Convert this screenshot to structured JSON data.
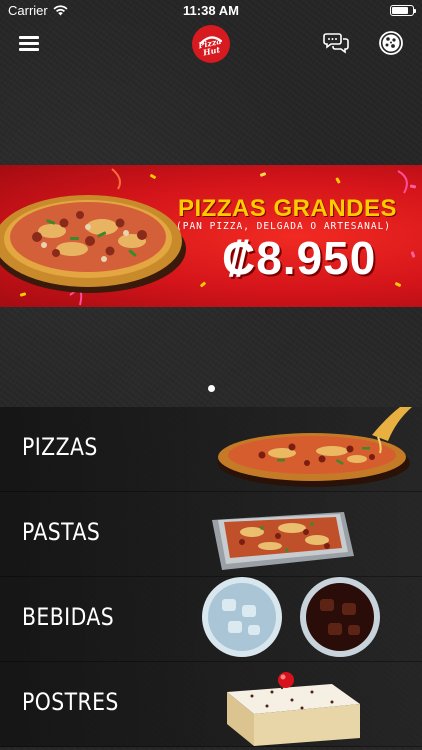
{
  "status_bar": {
    "carrier": "Carrier",
    "time": "11:38 AM"
  },
  "nav": {
    "logo_text_line1": "Pizza",
    "logo_text_line2": "Hut",
    "menu_icon": "hamburger-menu-icon",
    "chat_icon": "chat-bubbles-icon",
    "pizza_icon": "pizza-icon"
  },
  "banner": {
    "headline": "PIZZAS GRANDES",
    "subheadline": "(PAN PIZZA, DELGADA O ARTESANAL)",
    "price": "₡8.950"
  },
  "carousel": {
    "page_count": 1,
    "active_index": 0
  },
  "categories": [
    {
      "label": "PIZZAS"
    },
    {
      "label": "PASTAS"
    },
    {
      "label": "BEBIDAS"
    },
    {
      "label": "POSTRES"
    }
  ],
  "colors": {
    "brand_red": "#d71920",
    "banner_yellow": "#ffcc00",
    "background": "#262626"
  }
}
